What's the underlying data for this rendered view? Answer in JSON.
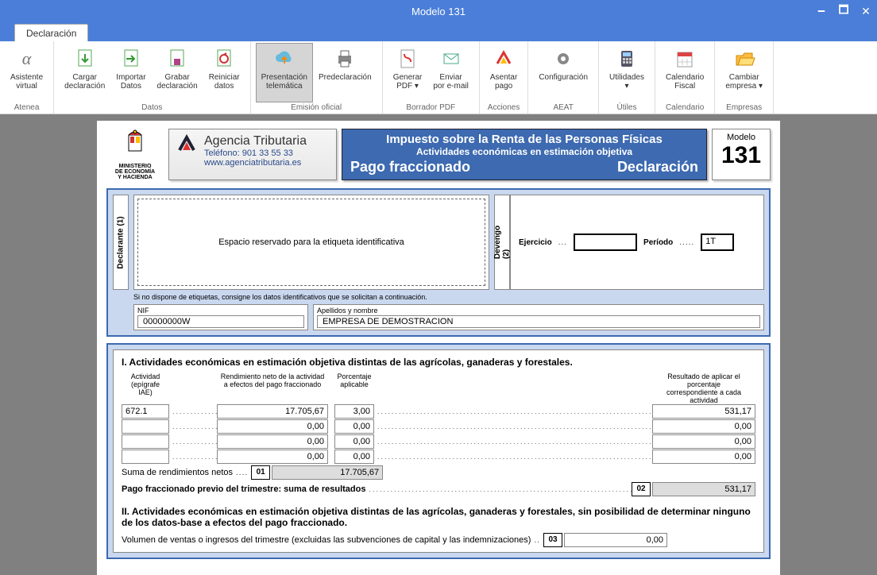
{
  "window": {
    "title": "Modelo 131"
  },
  "tabs": {
    "declaration": "Declaración"
  },
  "ribbon": {
    "atenea": {
      "label": "Atenea",
      "item": "Asistente\nvirtual"
    },
    "datos": {
      "label": "Datos",
      "cargar": "Cargar\ndeclaración",
      "importar": "Importar\nDatos",
      "grabar": "Grabar\ndeclaración",
      "reiniciar": "Reiniciar\ndatos"
    },
    "emision": {
      "label": "Emisión oficial",
      "presentacion": "Presentación\ntelemática",
      "predeclaracion": "Predeclaración"
    },
    "borrador": {
      "label": "Borrador PDF",
      "generar": "Generar\nPDF ▾",
      "enviar": "Enviar\npor e-mail"
    },
    "acciones": {
      "label": "Acciones",
      "asentar": "Asentar\npago"
    },
    "aeat": {
      "label": "AEAT",
      "config": "Configuración"
    },
    "utiles": {
      "label": "Útiles",
      "util": "Utilidades\n▾"
    },
    "calendario": {
      "label": "Calendario",
      "cal": "Calendario\nFiscal"
    },
    "empresas": {
      "label": "Empresas",
      "cambiar": "Cambiar\nempresa ▾"
    }
  },
  "form": {
    "ministry": "MINISTERIO\nDE ECONOMÍA\nY HACIENDA",
    "agency_name": "Agencia Tributaria",
    "agency_tel": "Teléfono: 901 33 55 33",
    "agency_web": "www.agenciatributaria.es",
    "blue_l1": "Impuesto sobre la Renta de las Personas Físicas",
    "blue_l2": "Actividades económicas en estimación objetiva",
    "blue_l3a": "Pago fraccionado",
    "blue_l3b": "Declaración",
    "model_label": "Modelo",
    "model_num": "131",
    "declarante_label": "Declarante (1)",
    "devengo_label": "Devengo\n(2)",
    "etiqueta": "Espacio reservado para la etiqueta identificativa",
    "ejercicio_label": "Ejercicio",
    "ejercicio_val": "",
    "periodo_label": "Período",
    "periodo_val": "1T",
    "etiq_note": "Si no dispone de etiquetas, consigne los datos identificativos que se solicitan a continuación.",
    "nif_label": "NIF",
    "nif_val": "00000000W",
    "nombre_label": "Apellidos y nombre",
    "nombre_val": "EMPRESA DE DEMOSTRACION",
    "sect1_title": "I.  Actividades económicas en estimación objetiva distintas de las agrícolas, ganaderas y forestales.",
    "col_act": "Actividad\n(epígrafe IAE)",
    "col_rend": "Rendimiento neto de la actividad\na efectos del pago fraccionado",
    "col_porc": "Porcentaje\naplicable",
    "col_res": "Resultado de aplicar el porcentaje\ncorrespondiente a cada actividad",
    "rows": [
      {
        "act": "672.1",
        "rend": "17.705,67",
        "porc": "3,00",
        "res": "531,17"
      },
      {
        "act": "",
        "rend": "0,00",
        "porc": "0,00",
        "res": "0,00"
      },
      {
        "act": "",
        "rend": "0,00",
        "porc": "0,00",
        "res": "0,00"
      },
      {
        "act": "",
        "rend": "0,00",
        "porc": "0,00",
        "res": "0,00"
      }
    ],
    "suma_label": "Suma de rendimientos netos",
    "suma_box": "01",
    "suma_val": "17.705,67",
    "pago_label": "Pago fraccionado previo del trimestre: suma de resultados",
    "pago_box": "02",
    "pago_val": "531,17",
    "sect2_title": "II.  Actividades económicas en estimación objetiva distintas de las agrícolas, ganaderas y forestales, sin posibilidad de determinar ninguno de los datos-base a efectos del pago fraccionado.",
    "volumen_label": "Volumen de ventas o ingresos del trimestre (excluidas las subvenciones de capital y las indemnizaciones)",
    "volumen_box": "03",
    "volumen_val": "0,00"
  }
}
